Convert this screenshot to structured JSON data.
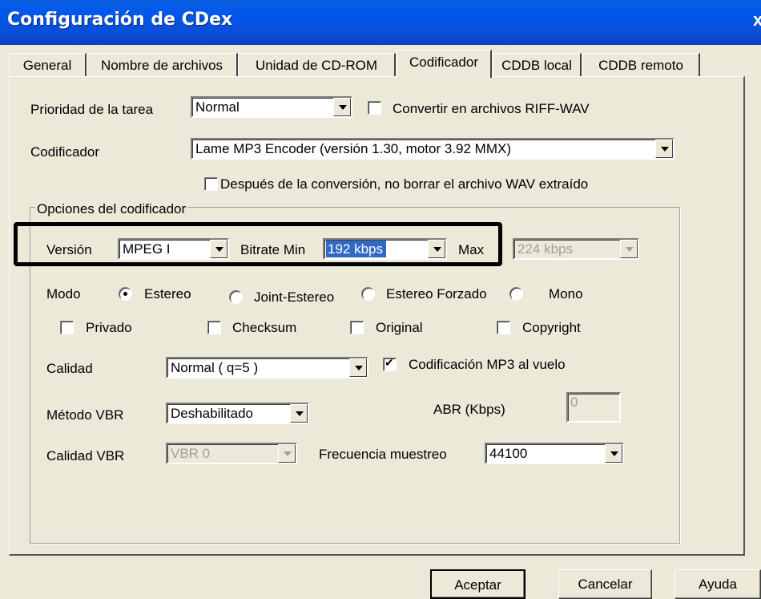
{
  "window": {
    "title": "Configuración de CDex",
    "close": "x"
  },
  "tabs": [
    {
      "label": "General"
    },
    {
      "label": "Nombre de archivos"
    },
    {
      "label": "Unidad de CD-ROM"
    },
    {
      "label": "Codificador"
    },
    {
      "label": "CDDB local"
    },
    {
      "label": "CDDB remoto"
    }
  ],
  "form": {
    "priority_label": "Prioridad de la tarea",
    "priority_value": "Normal",
    "riff_label": "Convertir en archivos RIFF-WAV",
    "encoder_label": "Codificador",
    "encoder_value": "Lame MP3 Encoder (versión 1.30, motor 3.92 MMX)",
    "keep_wav_label": "Después de la conversión, no borrar el archivo WAV extraído",
    "group_label": "Opciones del codificador",
    "version_label": "Versión",
    "version_value": "MPEG I",
    "bitrate_min_label": "Bitrate Min",
    "bitrate_min_value": "192 kbps",
    "max_label": "Max",
    "max_value": "224 kbps",
    "mode_label": "Modo",
    "mode_stereo": "Estereo",
    "mode_joint": "Joint-Estereo",
    "mode_forced": "Estereo Forzado",
    "mode_mono": "Mono",
    "private_label": "Privado",
    "checksum_label": "Checksum",
    "original_label": "Original",
    "copyright_label": "Copyright",
    "quality_label": "Calidad",
    "quality_value": "Normal ( q=5 )",
    "onthefly_label": "Codificación MP3 al vuelo",
    "vbr_method_label": "Método VBR",
    "vbr_method_value": "Deshabilitado",
    "abr_label": "ABR (Kbps)",
    "abr_value": "0",
    "vbr_quality_label": "Calidad VBR",
    "vbr_quality_value": "VBR 0",
    "freq_label": "Frecuencia muestreo",
    "freq_value": "44100"
  },
  "buttons": {
    "ok": "Aceptar",
    "cancel": "Cancelar",
    "help": "Ayuda"
  }
}
